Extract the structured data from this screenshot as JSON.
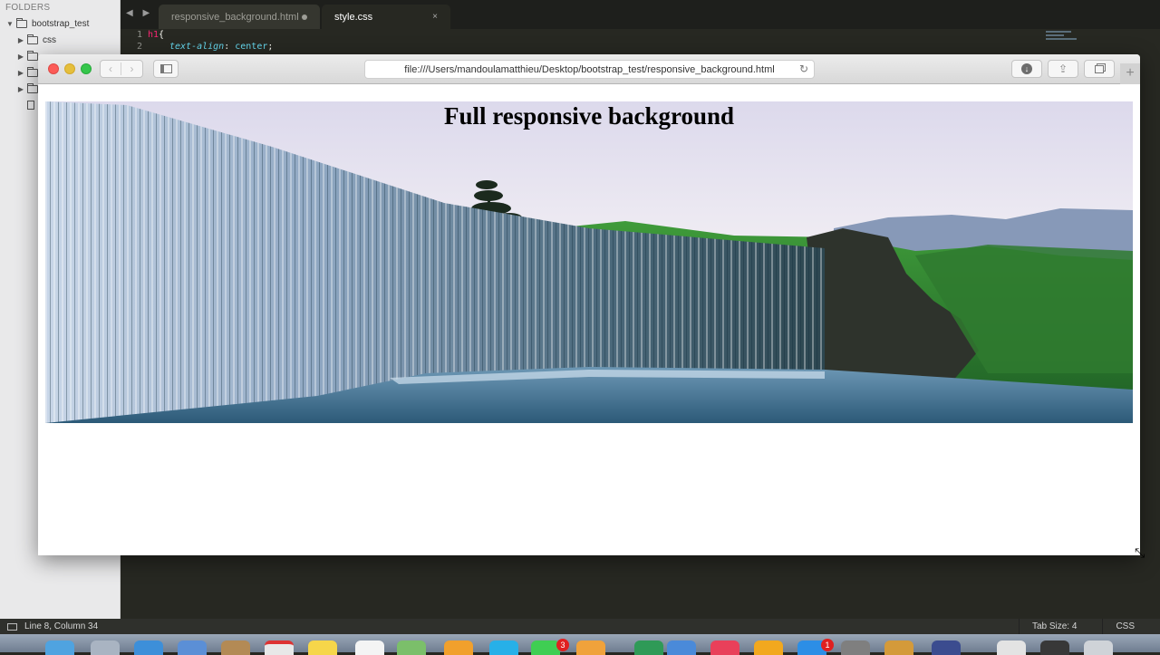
{
  "editor": {
    "sidebar": {
      "title": "FOLDERS",
      "items": [
        {
          "label": "bootstrap_test",
          "type": "folder",
          "expanded": true
        },
        {
          "label": "css",
          "type": "folder",
          "expanded": false
        },
        {
          "label": "",
          "type": "folder",
          "expanded": false
        },
        {
          "label": "",
          "type": "folder",
          "expanded": false
        },
        {
          "label": "",
          "type": "folder",
          "expanded": false
        },
        {
          "label": "",
          "type": "file"
        }
      ]
    },
    "tabs": [
      {
        "label": "responsive_background.html",
        "active": false,
        "modified": true
      },
      {
        "label": "style.css",
        "active": true,
        "close_glyph": "×"
      }
    ],
    "code_lines": [
      {
        "number": "1",
        "selector": "h1",
        "brace": "{"
      },
      {
        "number": "2",
        "property": "text-align",
        "colon": ":",
        "value": "center",
        "semi": ";"
      }
    ],
    "status": {
      "position": "Line 8, Column 34",
      "tab_size": "Tab Size: 4",
      "syntax": "CSS"
    }
  },
  "browser": {
    "url": "file:///Users/mandoulamatthieu/Desktop/bootstrap_test/responsive_background.html",
    "back_glyph": "‹",
    "forward_glyph": "›",
    "reload_glyph": "↻",
    "download_glyph": "↓",
    "share_glyph": "⇪",
    "new_tab_glyph": "+",
    "page": {
      "heading": "Full responsive background"
    }
  },
  "dock": {
    "badges": [
      "3",
      "1"
    ]
  },
  "colors": {
    "editor_bg": "#272822",
    "keyword": "#f92672",
    "property": "#66d9ef",
    "close": "#fc5b57",
    "minimize": "#e5bf3c",
    "maximize": "#35c64b"
  },
  "icons": {
    "back": "chevron-left-icon",
    "forward": "chevron-right-icon",
    "sidebar": "sidebar-icon",
    "reload": "reload-icon",
    "download": "download-icon",
    "share": "share-icon",
    "tabs": "tabs-overview-icon",
    "new_tab": "plus-icon",
    "resize": "resize-cursor-icon"
  }
}
